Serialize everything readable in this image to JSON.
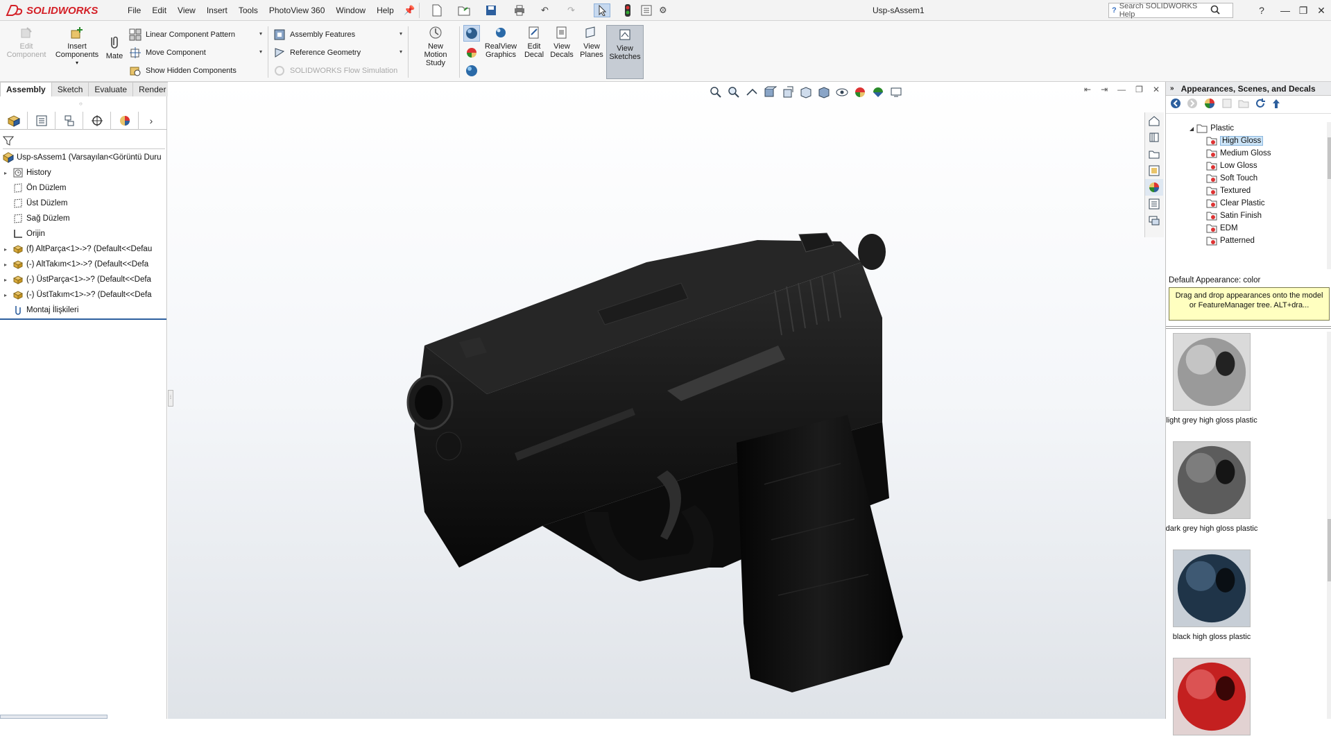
{
  "app": {
    "brand": "SOLIDWORKS",
    "document_title": "Usp-sAssem1"
  },
  "menu": [
    "File",
    "Edit",
    "View",
    "Insert",
    "Tools",
    "PhotoView 360",
    "Window",
    "Help"
  ],
  "search": {
    "placeholder": "Search SOLIDWORKS Help"
  },
  "commands": {
    "edit_component": "Edit\nComponent",
    "insert_components": "Insert\nComponents",
    "mate": "Mate",
    "linear_pattern": "Linear Component Pattern",
    "move_component": "Move Component",
    "show_hidden": "Show Hidden Components",
    "assembly_features": "Assembly Features",
    "reference_geometry": "Reference Geometry",
    "flow_simulation": "SOLIDWORKS Flow Simulation",
    "new_motion_study": "New\nMotion\nStudy",
    "realview": "RealView\nGraphics",
    "edit_decal": "Edit\nDecal",
    "view_decals": "View\nDecals",
    "view_planes": "View\nPlanes",
    "view_sketches": "View\nSketches"
  },
  "tabs": [
    {
      "label": "Assembly",
      "active": true
    },
    {
      "label": "Sketch",
      "active": false
    },
    {
      "label": "Evaluate",
      "active": false
    },
    {
      "label": "Render Tools",
      "active": false
    }
  ],
  "feature_tree": {
    "root": "Usp-sAssem1  (Varsayılan<Görüntü Duru",
    "items": [
      {
        "label": "History",
        "icon": "history-icon",
        "expandable": true
      },
      {
        "label": "Ön Düzlem",
        "icon": "plane-icon",
        "expandable": false
      },
      {
        "label": "Üst Düzlem",
        "icon": "plane-icon",
        "expandable": false
      },
      {
        "label": "Sağ Düzlem",
        "icon": "plane-icon",
        "expandable": false
      },
      {
        "label": "Orijin",
        "icon": "origin-icon",
        "expandable": false
      },
      {
        "label": "(f) AltParça<1>->? (Default<<Defau",
        "icon": "part-icon",
        "expandable": true
      },
      {
        "label": "(-) AltTakım<1>->? (Default<<Defa",
        "icon": "subassembly-icon",
        "expandable": true
      },
      {
        "label": "(-) ÜstParça<1>->? (Default<<Defa",
        "icon": "part-icon",
        "expandable": true
      },
      {
        "label": "(-) ÜstTakım<1>->? (Default<<Defa",
        "icon": "subassembly-icon",
        "expandable": true
      },
      {
        "label": "Montaj İlişkileri",
        "icon": "mates-icon",
        "expandable": false
      }
    ]
  },
  "task_pane": {
    "title": "Appearances, Scenes, and Decals",
    "folder": "Plastic",
    "subfolders": [
      "High Gloss",
      "Medium Gloss",
      "Low Gloss",
      "Soft Touch",
      "Textured",
      "Clear Plastic",
      "Satin Finish",
      "EDM",
      "Patterned"
    ],
    "selected": "High Gloss",
    "default_appearance": "Default Appearance: color",
    "tooltip": "Drag and drop appearances onto the model or FeatureManager tree.  ALT+dra...",
    "swatches": [
      {
        "label": "light grey high gloss plastic",
        "color": "#9a9a9a"
      },
      {
        "label": "dark grey high gloss plastic",
        "color": "#5c5c5c"
      },
      {
        "label": "black high gloss plastic",
        "color": "#1f3448"
      },
      {
        "label": "",
        "color": "#c42020"
      }
    ]
  },
  "colors": {
    "brand_red": "#d42027",
    "highlight": "#cce4f7",
    "tooltip_bg": "#ffffc0"
  }
}
